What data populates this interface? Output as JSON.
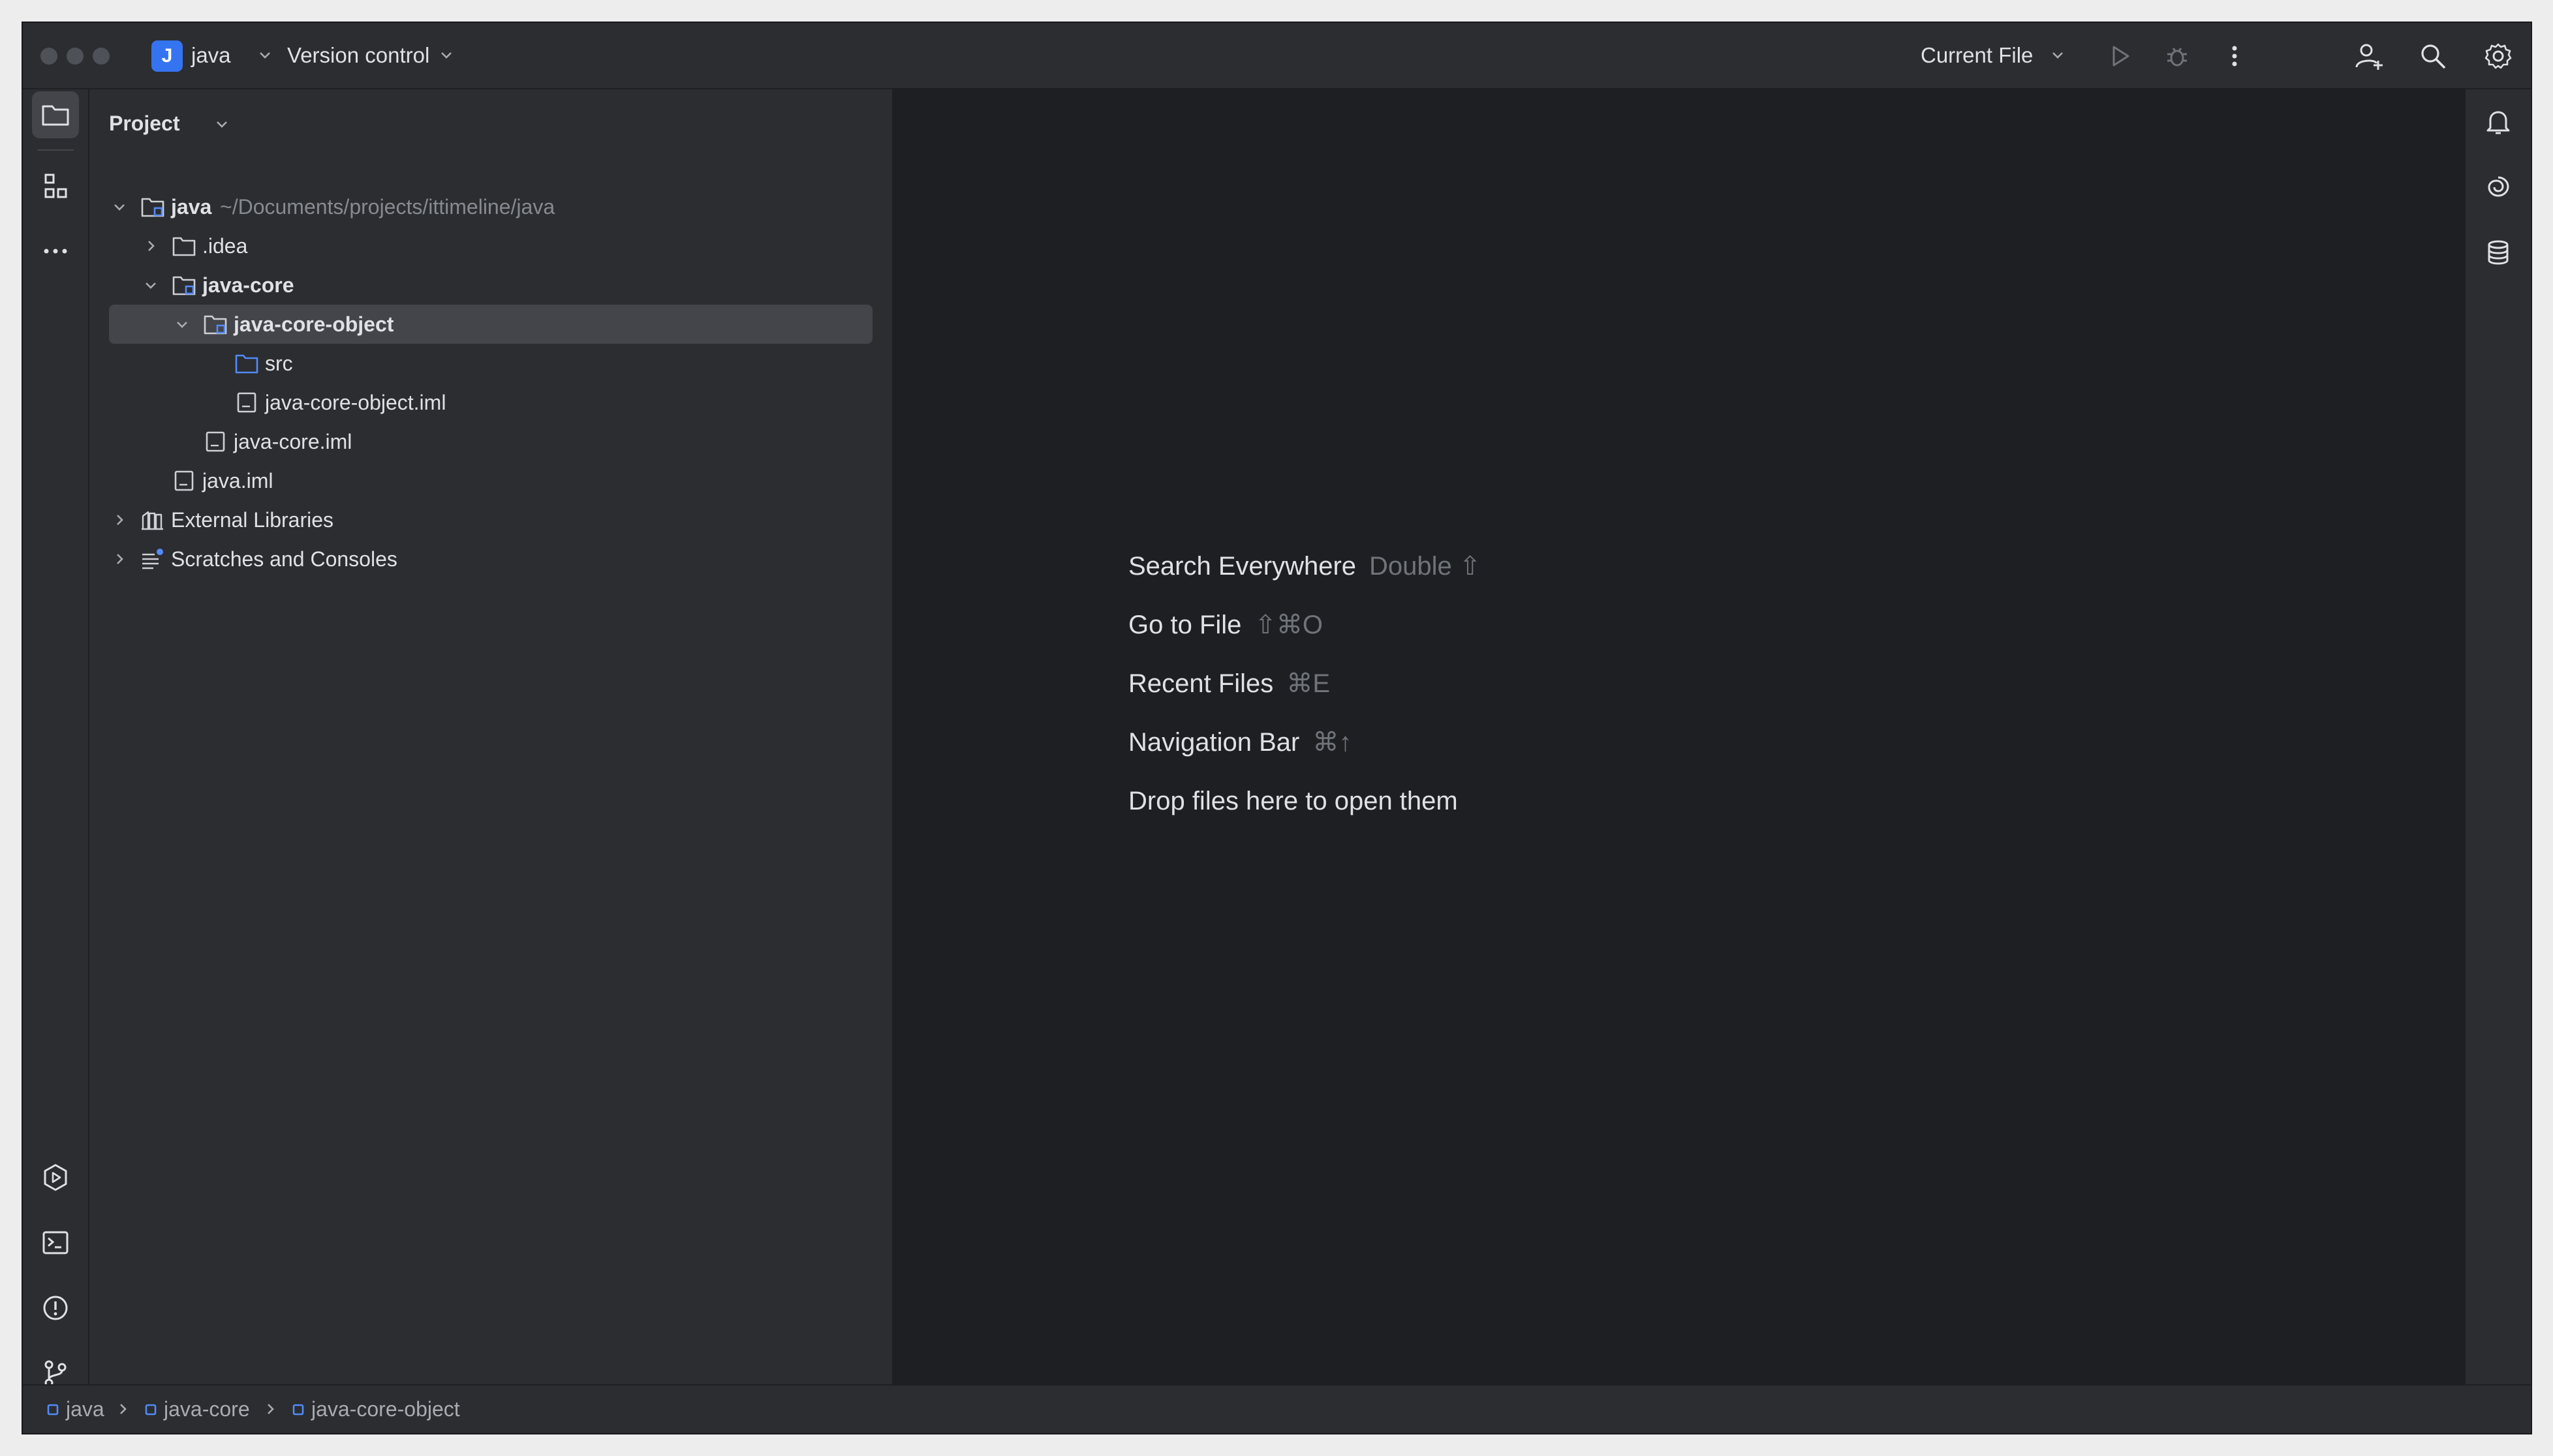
{
  "titlebar": {
    "project_initial": "J",
    "project_name": "java",
    "vcs_label": "Version control",
    "run_config": "Current File"
  },
  "project_panel": {
    "title": "Project",
    "tree": [
      {
        "label": "java",
        "hint": "~/Documents/projects/ittimeline/java",
        "icon": "module-folder-icon",
        "bold": true,
        "expanded": true
      },
      {
        "label": ".idea",
        "icon": "folder-icon",
        "collapsed": true
      },
      {
        "label": "java-core",
        "icon": "module-folder-icon",
        "bold": true,
        "expanded": true
      },
      {
        "label": "java-core-object",
        "icon": "module-folder-icon",
        "bold": true,
        "expanded": true,
        "selected": true
      },
      {
        "label": "src",
        "icon": "source-folder-icon"
      },
      {
        "label": "java-core-object.iml",
        "icon": "file-icon"
      },
      {
        "label": "java-core.iml",
        "icon": "file-icon"
      },
      {
        "label": "java.iml",
        "icon": "file-icon"
      },
      {
        "label": "External Libraries",
        "icon": "library-icon",
        "collapsed": true
      },
      {
        "label": "Scratches and Consoles",
        "icon": "scratches-icon",
        "collapsed": true
      }
    ]
  },
  "editor_hints": [
    {
      "action": "Search Everywhere",
      "shortcut": "Double ⇧"
    },
    {
      "action": "Go to File",
      "shortcut": "⇧⌘O"
    },
    {
      "action": "Recent Files",
      "shortcut": "⌘E"
    },
    {
      "action": "Navigation Bar",
      "shortcut": "⌘↑"
    },
    {
      "action": "Drop files here to open them",
      "shortcut": ""
    }
  ],
  "breadcrumbs": [
    "java",
    "java-core",
    "java-core-object"
  ],
  "colors": {
    "accent": "#3574f0",
    "background": "#1e1f22",
    "panel": "#2b2d30",
    "selection": "#43454a",
    "text": "#dfe1e5",
    "muted": "#868a91"
  }
}
